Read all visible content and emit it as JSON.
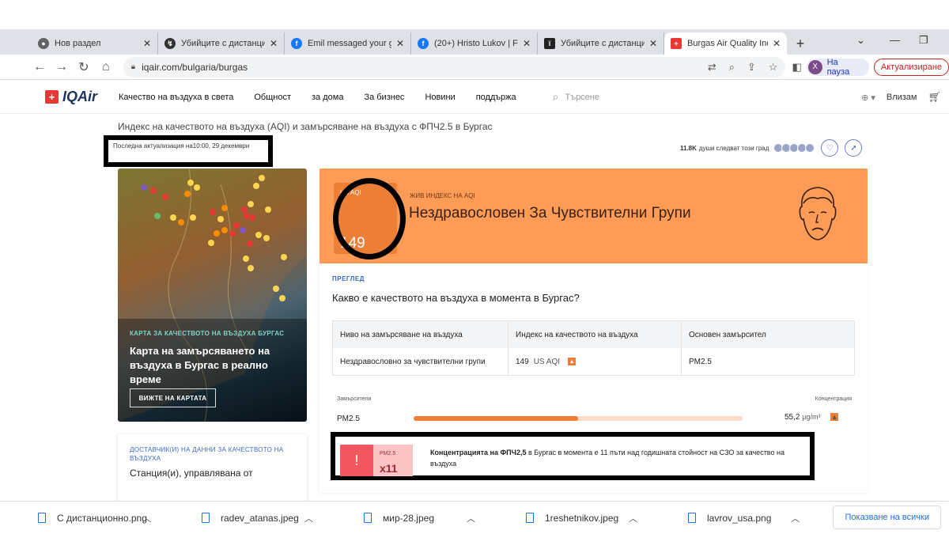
{
  "tabs": [
    {
      "title": "Нов раздел",
      "icon": "globe-icon",
      "color": "#5f6368"
    },
    {
      "title": "Убийците с дистанци",
      "icon": "site-icon",
      "color": "#333333"
    },
    {
      "title": "Emil messaged your g",
      "icon": "facebook-icon",
      "color": "#1877f2"
    },
    {
      "title": "(20+) Hristo Lukov | Fa",
      "icon": "facebook-icon",
      "color": "#1877f2"
    },
    {
      "title": "Убийците с дистанци",
      "icon": "site-icon",
      "color": "#222222"
    },
    {
      "title": "Burgas Air Quality Ind",
      "icon": "iqair-icon",
      "color": "#e53935"
    }
  ],
  "toolbar": {
    "url": "iqair.com/bulgaria/burgas",
    "pause_label": "На пауза",
    "avatar_letter": "X",
    "update_label": "Актуализиране"
  },
  "site_nav": {
    "logo": "IQAir",
    "links": [
      "Качество на въздуха в света",
      "Общност",
      "за дома",
      "За бизнес",
      "Новини",
      "поддържа"
    ],
    "search_placeholder": "Търсене",
    "login": "Влизам"
  },
  "page": {
    "subtitle": "Индекс на качеството на въздуха (AQI) и замърсяване на въздуха с ФПЧ2.5 в Бургас",
    "last_updated": "Последна актуализация на10:00, 29 декември",
    "followers_count": "11.8K",
    "followers_text": "души следват този град"
  },
  "map_card": {
    "label": "КАРТА ЗА КАЧЕСТВОТО НА ВЪЗДУХА БУРГАС",
    "title": "Карта на замърсяването на въздуха в Бургас в реално време",
    "button": "ВИЖТЕ НА КАРТАТА"
  },
  "provider_card": {
    "label": "ДОСТАВЧИК(И) НА ДАННИ ЗА КАЧЕСТВОТО НА ВЪЗДУХА",
    "station": "Станция(и), управлявана от"
  },
  "aqi": {
    "label": "US AQI",
    "value": "149",
    "live_label": "ЖИВ ИНДЕКС НА AQI",
    "status": "Нездравословен За Чувствителни Групи",
    "color": "#fe9b57"
  },
  "overview": {
    "label": "ПРЕГЛЕД",
    "question": "Какво е качеството на въздуха в момента в Бургас?",
    "headers": [
      "Ниво на замърсяване на въздуха",
      "Индекс на качеството на въздуха",
      "Основен замърсител"
    ],
    "row": {
      "level": "Нездравословно за чувствителни групи",
      "index": "149",
      "index_unit": "US AQI",
      "pollutant": "PM2.5"
    }
  },
  "pollutants": {
    "header_left": "Замърсители",
    "header_right": "Концентрация",
    "name": "PM2.5",
    "value": "55,2",
    "unit": "µg/m³",
    "bar_fraction": 0.5
  },
  "alert": {
    "icon": "!",
    "pm_label": "PM2.5",
    "multiplier": "x11",
    "bold": "Концентрацията на ФПЧ2,5",
    "text": " в Бургас в момента е 11 пъти над годишната стойност на СЗО за качество на въздуха"
  },
  "downloads": {
    "files": [
      "С дистанционно.png",
      "radev_atanas.jpeg",
      "мир-28.jpeg",
      "1reshetnikov.jpeg",
      "lavrov_usa.png"
    ],
    "show_all": "Показване на всички"
  }
}
